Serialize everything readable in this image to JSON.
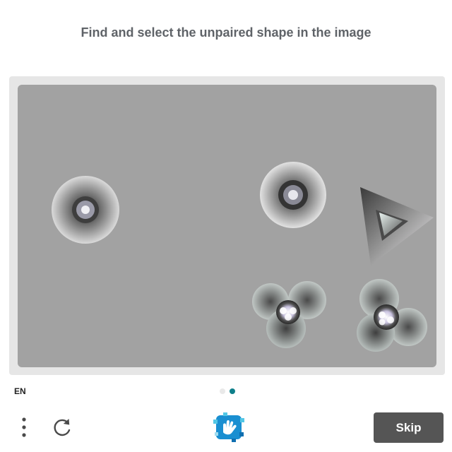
{
  "prompt": "Find and select the unpaired shape in the image",
  "language": "EN",
  "pagination": {
    "total": 2,
    "current": 2
  },
  "skip_label": "Skip",
  "colors": {
    "prompt_text": "#5f6368",
    "frame_bg": "#e6e6e6",
    "canvas_bg": "#a2a2a2",
    "dot_active": "#0e7f8a",
    "dot_inactive": "#e9e9e9",
    "skip_bg": "#555555",
    "logo_blue": "#1a8fd1",
    "logo_cyan": "#53c7e6"
  },
  "icons": {
    "menu": "vertical-ellipsis-icon",
    "refresh": "refresh-icon",
    "logo": "hand-logo-icon"
  },
  "shapes": [
    {
      "name": "circle-shape-left",
      "kind": "ring"
    },
    {
      "name": "circle-shape-right",
      "kind": "ring"
    },
    {
      "name": "triangle-shape",
      "kind": "triangle"
    },
    {
      "name": "clover-shape-left",
      "kind": "clover"
    },
    {
      "name": "clover-shape-right",
      "kind": "clover"
    }
  ]
}
